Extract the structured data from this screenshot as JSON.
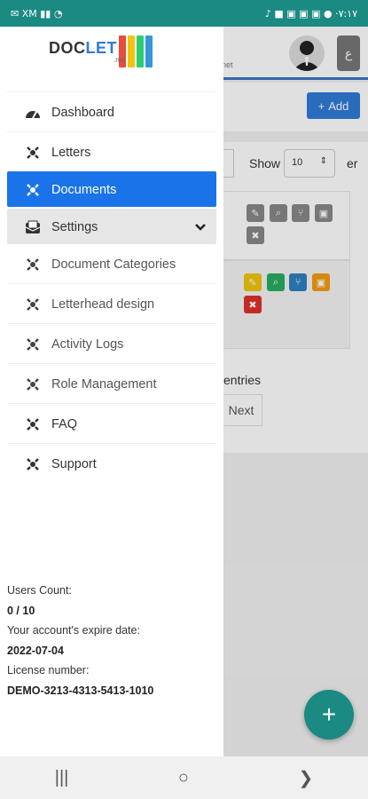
{
  "status_bar": {
    "left_text": "✉ XM ▮▮ ◔",
    "right_text": "♪ ■ ▣ ▣ ▣ ● ·٧:١٧"
  },
  "background_app": {
    "header_fragment": "net",
    "add_button": "Add",
    "show_label": "Show",
    "show_value": "10",
    "show_after": "er",
    "entries_text": "entries",
    "next_button": "Next",
    "lang_button": "ع"
  },
  "brand": {
    "doc": "DOC",
    "let": "LET",
    "net": ".net",
    "folder_colors": [
      "#e74c3c",
      "#f1c40f",
      "#2ecc71",
      "#3498db"
    ]
  },
  "menu": [
    {
      "label": "Dashboard",
      "icon": "dashboard-icon"
    },
    {
      "label": "Letters",
      "icon": "letters-icon"
    },
    {
      "label": "Documents",
      "icon": "documents-icon",
      "active": true
    },
    {
      "label": "Settings",
      "icon": "settings-icon",
      "expandable": true
    },
    {
      "label": "Document Categories",
      "icon": "categories-icon"
    },
    {
      "label": "Letterhead design",
      "icon": "letterhead-icon"
    },
    {
      "label": "Activity Logs",
      "icon": "activity-logs-icon"
    },
    {
      "label": "Role Management",
      "icon": "role-icon"
    },
    {
      "label": "FAQ",
      "icon": "faq-icon"
    },
    {
      "label": "Support",
      "icon": "support-icon"
    }
  ],
  "footer": {
    "users_count_label": "Users Count:",
    "users_count_value": "0 / 10",
    "expire_label": "Your account's expire date:",
    "expire_value": "2022-07-04",
    "license_label": "License number:",
    "license_value": "DEMO-3213-4313-5413-1010"
  },
  "fab_symbol": "+",
  "nav_bar": {
    "recent": "|||",
    "home": "○",
    "back": "❯"
  },
  "colors": {
    "accent_teal": "#1a8a83",
    "active_blue": "#1a73e8",
    "action_yellow": "#f1c40f",
    "action_green": "#27ae60",
    "action_blue": "#2f80c0",
    "action_orange": "#f39c12",
    "action_red": "#e0302b"
  }
}
